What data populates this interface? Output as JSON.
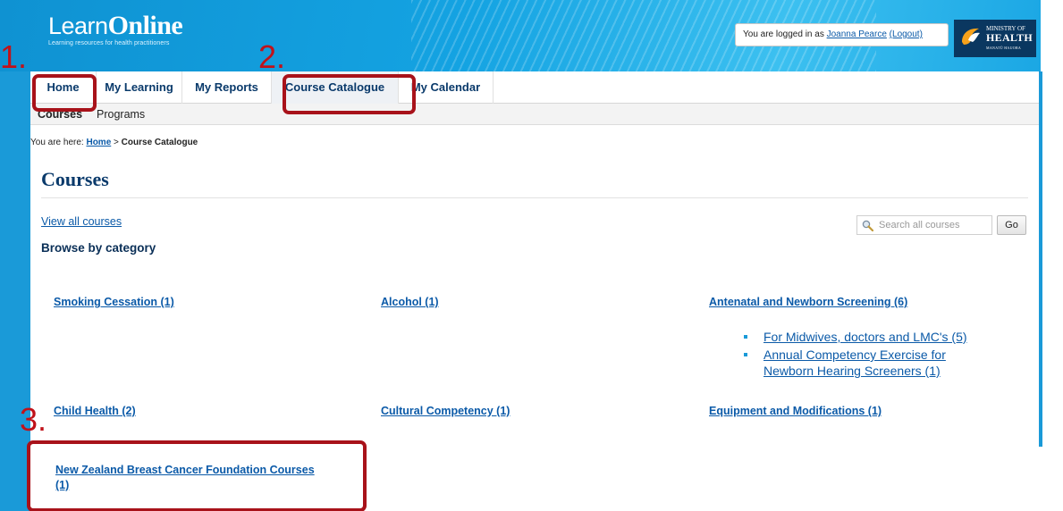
{
  "header": {
    "logo_light": "Learn",
    "logo_bold": "Online",
    "logo_tagline": "Learning resources for health practitioners",
    "login_prefix": "You are logged in as",
    "user_name": "Joanna Pearce",
    "logout_label": "(Logout)",
    "ministry_line1": "MINISTRY OF",
    "ministry_line2": "HEALTH",
    "ministry_line3": "MANATŪ HAUORA"
  },
  "nav": {
    "items": [
      {
        "label": "Home"
      },
      {
        "label": "My Learning"
      },
      {
        "label": "My Reports"
      },
      {
        "label": "Course Catalogue"
      },
      {
        "label": "My Calendar"
      }
    ],
    "subitems": [
      {
        "label": "Courses"
      },
      {
        "label": "Programs"
      }
    ]
  },
  "breadcrumb": {
    "prefix": "You are here:",
    "home": "Home",
    "separator": ">",
    "current": "Course Catalogue"
  },
  "page": {
    "title": "Courses",
    "view_all": "View all courses",
    "browse_heading": "Browse by category"
  },
  "search": {
    "placeholder": "Search all courses",
    "go_label": "Go"
  },
  "categories": [
    {
      "label": "Smoking Cessation (1)"
    },
    {
      "label": "Alcohol (1)"
    },
    {
      "label": "Antenatal and Newborn Screening (6)"
    },
    {
      "label": "Child Health (2)"
    },
    {
      "label": "Cultural Competency (1)"
    },
    {
      "label": "Equipment and Modifications (1)"
    },
    {
      "label_line1": "New Zealand Breast Cancer Foundation Courses",
      "label_line2": "(1)"
    }
  ],
  "subcategories": [
    {
      "label": "For Midwives, doctors and LMC's (5)"
    },
    {
      "label_line1": "Annual Competency Exercise for",
      "label_line2": "Newborn Hearing Screeners (1)"
    }
  ],
  "annotations": [
    {
      "label": "1."
    },
    {
      "label": "2."
    },
    {
      "label": "3."
    }
  ],
  "colors": {
    "banner_blue": "#14a3e2",
    "nav_text": "#0a3a6b",
    "link": "#0b5aa8",
    "annotation_red": "#c0121a"
  }
}
